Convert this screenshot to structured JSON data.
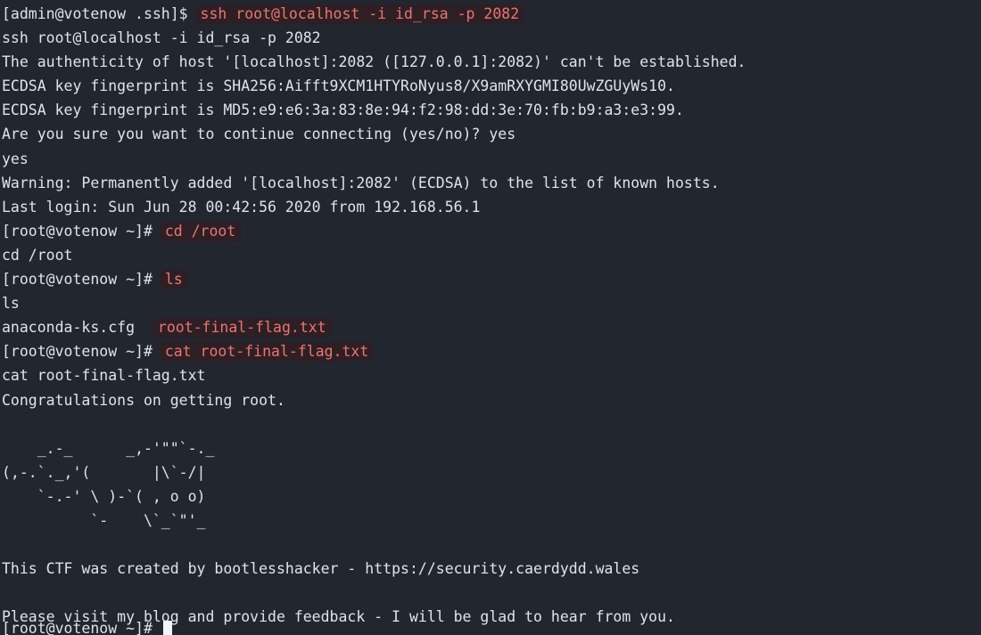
{
  "terminal": {
    "background_color": "#22262f",
    "foreground_color": "#dfe3ec",
    "highlight_text_color": "#e8776f",
    "highlight_background_color": "#2e1f25",
    "cursor_color": "#f2f4f8"
  },
  "session": {
    "prompt_user": "[admin@votenow .ssh]$ ",
    "prompt_root": "[root@votenow ~]# ",
    "command_ssh": "ssh root@localhost -i id_rsa -p 2082",
    "echo_ssh": "ssh root@localhost -i id_rsa -p 2082",
    "authenticity_line": "The authenticity of host '[localhost]:2082 ([127.0.0.1]:2082)' can't be established.",
    "fingerprint_sha256": "ECDSA key fingerprint is SHA256:Aifft9XCM1HTYRoNyus8/X9amRXYGMI80UwZGUyWs10.",
    "fingerprint_md5": "ECDSA key fingerprint is MD5:e9:e6:3a:83:8e:94:f2:98:dd:3e:70:fb:b9:a3:e3:99.",
    "confirm_prompt": "Are you sure you want to continue connecting (yes/no)? yes",
    "confirm_echo": "yes",
    "warning_known_hosts": "Warning: Permanently added '[localhost]:2082' (ECDSA) to the list of known hosts.",
    "last_login": "Last login: Sun Jun 28 00:42:56 2020 from 192.168.56.1",
    "command_cd": "cd /root",
    "echo_cd": "cd /root",
    "command_ls": "ls",
    "echo_ls": "ls",
    "ls_output_file_plain": "anaconda-ks.cfg  ",
    "ls_output_file_flag": "root-final-flag.txt",
    "command_cat": "cat root-final-flag.txt",
    "echo_cat": "cat root-final-flag.txt",
    "flag_message": "Congratulations on getting root.",
    "credit_line": "This CTF was created by bootlesshacker - https://security.caerdydd.wales",
    "feedback_line": "Please visit my blog and provide feedback - I will be glad to hear from you.",
    "final_prompt": "[root@votenow ~]# "
  },
  "ascii_art": {
    "line1": "    _.-_      _,-'\"\"`-._",
    "line2": "(,-.`._,'(       |\\`-/|",
    "line3": "    `-.-' \\ )-`( , o o)",
    "line4": "          `-    \\`_`\"'_"
  }
}
